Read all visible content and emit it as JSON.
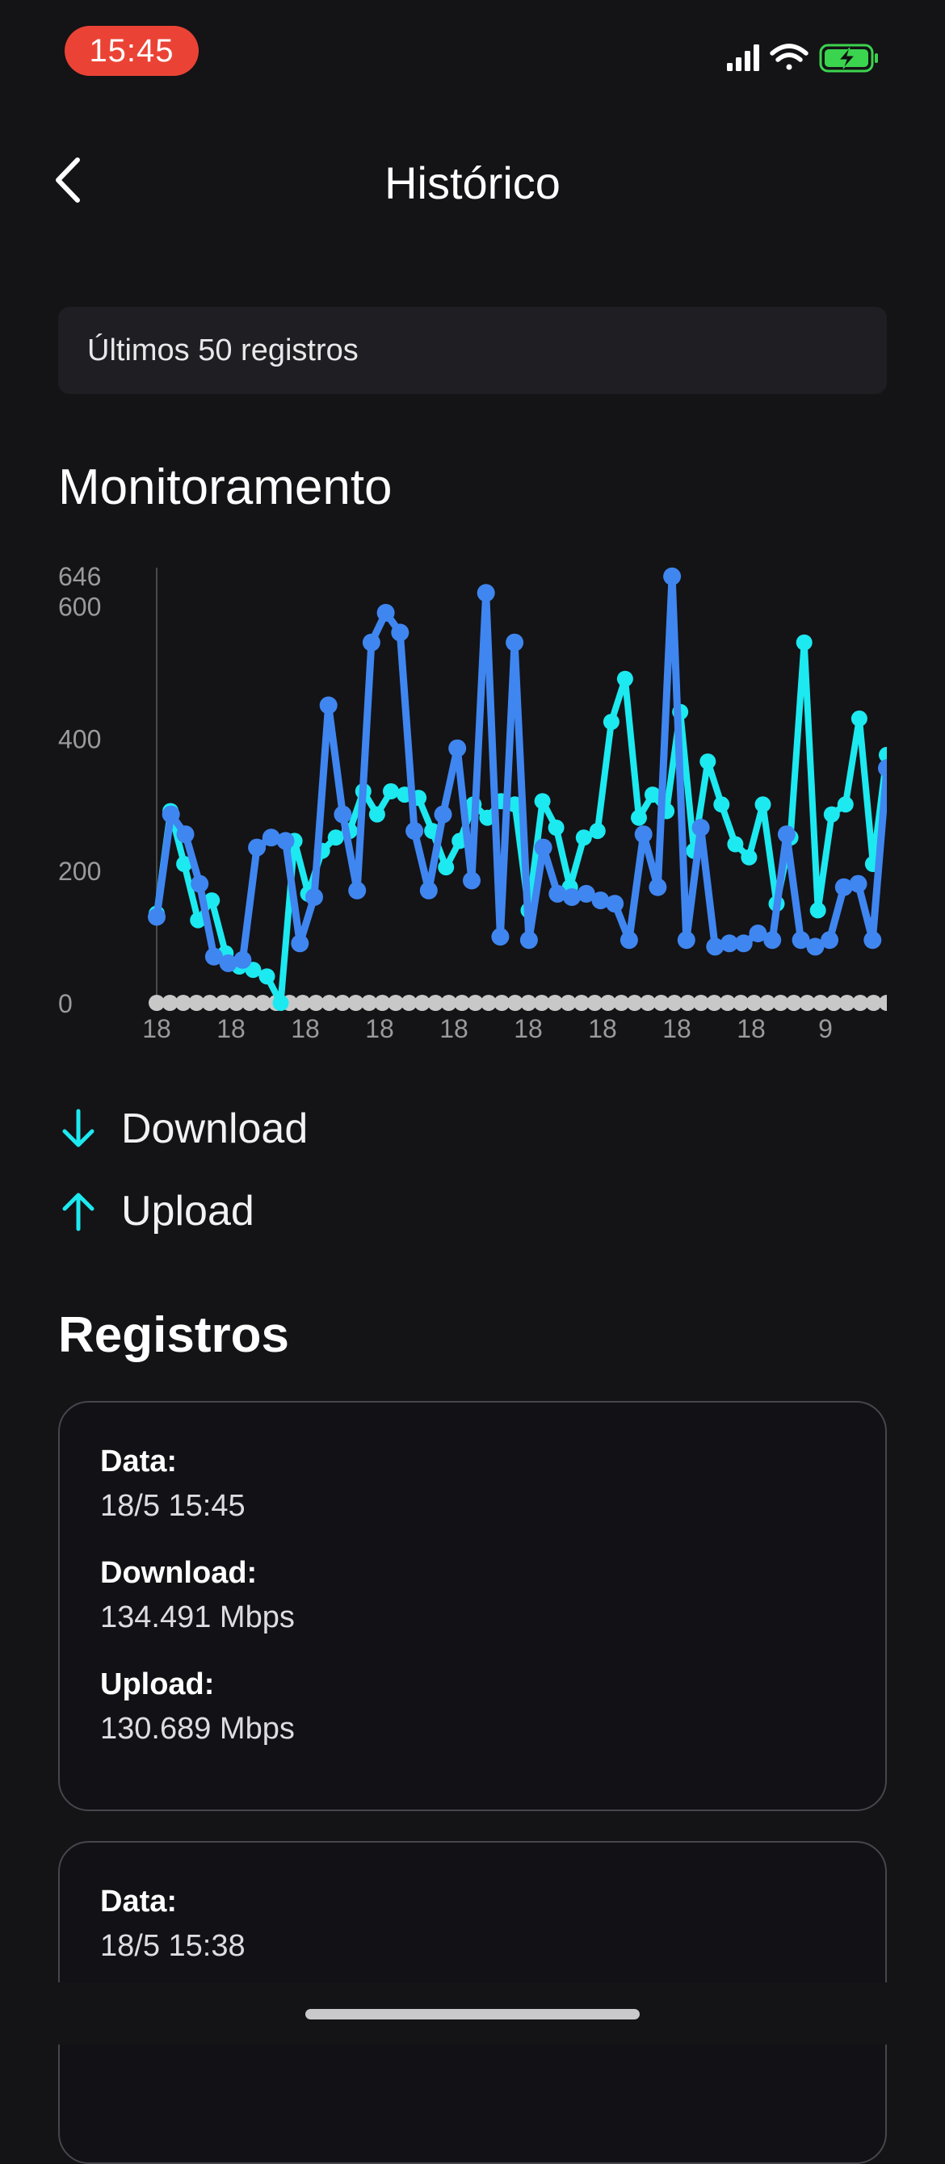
{
  "status": {
    "time": "15:45"
  },
  "nav": {
    "title": "Histórico"
  },
  "filter": {
    "label": "Últimos 50 registros"
  },
  "sections": {
    "monitor_title": "Monitoramento",
    "records_title": "Registros"
  },
  "legend": {
    "download": "Download",
    "upload": "Upload"
  },
  "colors": {
    "download": "#1de9f0",
    "upload": "#3f86f0",
    "zero": "#c8c8c8",
    "background": "#141316"
  },
  "icons": {
    "back": "chevron-left-icon",
    "download": "arrow-down-icon",
    "upload": "arrow-up-icon"
  },
  "records": [
    {
      "date_label": "Data:",
      "date": "18/5 15:45",
      "download_label": "Download:",
      "download": "134.491 Mbps",
      "upload_label": "Upload:",
      "upload": "130.689 Mbps"
    },
    {
      "date_label": "Data:",
      "date": "18/5 15:38"
    }
  ],
  "chart_data": {
    "type": "line",
    "ylim": [
      0,
      646
    ],
    "yticks": [
      "0",
      "200",
      "400",
      "600",
      "646"
    ],
    "xtick_labels": [
      "18",
      "18",
      "18",
      "18",
      "18",
      "18",
      "18",
      "18",
      "18",
      "9",
      "9"
    ],
    "series": [
      {
        "name": "Download",
        "values": [
          135,
          290,
          210,
          125,
          155,
          75,
          55,
          50,
          40,
          0,
          245,
          165,
          230,
          250,
          260,
          320,
          285,
          320,
          315,
          310,
          260,
          205,
          245,
          300,
          280,
          305,
          300,
          140,
          305,
          265,
          175,
          250,
          260,
          425,
          490,
          280,
          315,
          290,
          440,
          230,
          365,
          300,
          240,
          220,
          300,
          150,
          250,
          545,
          140,
          285,
          300,
          430,
          210,
          375
        ]
      },
      {
        "name": "Upload",
        "values": [
          130,
          285,
          255,
          180,
          70,
          60,
          65,
          235,
          250,
          245,
          90,
          160,
          450,
          285,
          170,
          545,
          590,
          560,
          260,
          170,
          285,
          385,
          185,
          620,
          100,
          545,
          95,
          235,
          165,
          160,
          165,
          155,
          150,
          95,
          255,
          175,
          645,
          95,
          265,
          85,
          90,
          90,
          105,
          95,
          255,
          95,
          85,
          95,
          175,
          180,
          95,
          355
        ]
      },
      {
        "name": "",
        "values": [
          0,
          0,
          0,
          0,
          0,
          0,
          0,
          0,
          0,
          0,
          0,
          0,
          0,
          0,
          0,
          0,
          0,
          0,
          0,
          0,
          0,
          0,
          0,
          0,
          0,
          0,
          0,
          0,
          0,
          0,
          0,
          0,
          0,
          0,
          0,
          0,
          0,
          0,
          0,
          0,
          0,
          0,
          0,
          0,
          0,
          0,
          0,
          0,
          0,
          0,
          0,
          0,
          0,
          0,
          0,
          0
        ]
      }
    ]
  }
}
